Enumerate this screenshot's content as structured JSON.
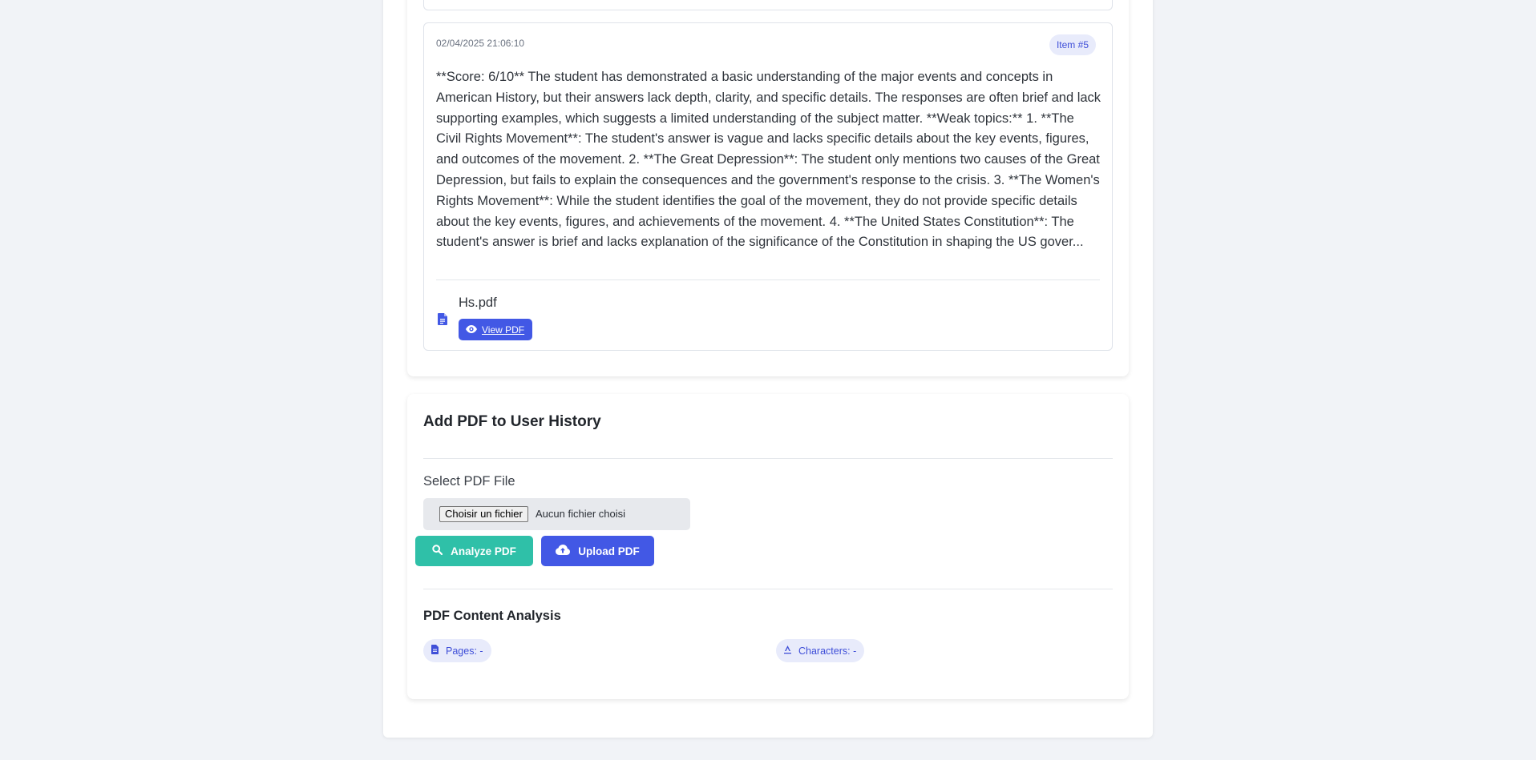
{
  "history_item": {
    "date": "02/04/2025 21:06:10",
    "badge": "Item #5",
    "text": "**Score: 6/10** The student has demonstrated a basic understanding of the major events and concepts in American History, but their answers lack depth, clarity, and specific details. The responses are often brief and lack supporting examples, which suggests a limited understanding of the subject matter. **Weak topics:** 1. **The Civil Rights Movement**: The student's answer is vague and lacks specific details about the key events, figures, and outcomes of the movement. 2. **The Great Depression**: The student only mentions two causes of the Great Depression, but fails to explain the consequences and the government's response to the crisis. 3. **The Women's Rights Movement**: While the student identifies the goal of the movement, they do not provide specific details about the key events, figures, and achievements of the movement. 4. **The United States Constitution**: The student's answer is brief and lacks explanation of the significance of the Constitution in shaping the US gover...",
    "file_name": "Hs.pdf",
    "view_label": "View PDF"
  },
  "add_pdf": {
    "title": "Add PDF to User History",
    "select_label": "Select PDF File",
    "choose_file_label": "Choisir un fichier",
    "no_file_text": "Aucun fichier choisi",
    "analyze_label": "Analyze PDF",
    "upload_label": "Upload PDF"
  },
  "analysis": {
    "title": "PDF Content Analysis",
    "pages_label": "Pages: -",
    "characters_label": "Characters: -"
  },
  "colors": {
    "primary": "#4258e5",
    "accent": "#2fc0a8",
    "badge_bg": "#e8ebfb",
    "background": "#f1f3f7"
  },
  "icons": {
    "file": "file-document-icon",
    "view": "eye-icon",
    "analyze": "search-icon",
    "upload": "cloud-upload-icon",
    "pages": "file-icon",
    "characters": "text-height-icon"
  }
}
